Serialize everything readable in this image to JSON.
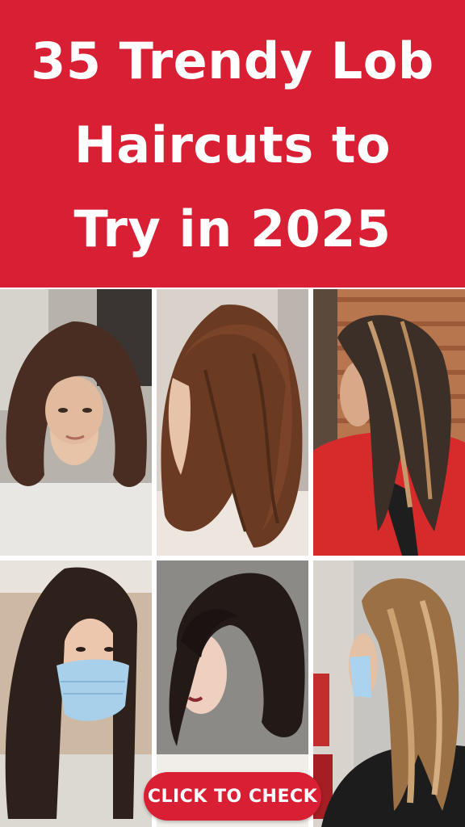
{
  "header": {
    "title_lines": [
      "35 Trendy Lob",
      "Haircuts to",
      "Try in 2025"
    ],
    "background_color": "#d91f33",
    "text_color": "#ffffff"
  },
  "photos": [
    {
      "hair": "wavy dark brown bob",
      "top": "white tee"
    },
    {
      "hair": "wavy chestnut lob",
      "top": "cream knit"
    },
    {
      "hair": "angled lob with blonde highlights",
      "top": "red jacket"
    },
    {
      "hair": "straight dark brown lob",
      "top": "blue face mask"
    },
    {
      "hair": "dark bob with curtain bangs",
      "top": "white blouse"
    },
    {
      "hair": "sleek blonde balayage lob",
      "top": "blue face mask"
    }
  ],
  "cta": {
    "label": "CLICK TO CHECK",
    "color": "#d91f33"
  }
}
